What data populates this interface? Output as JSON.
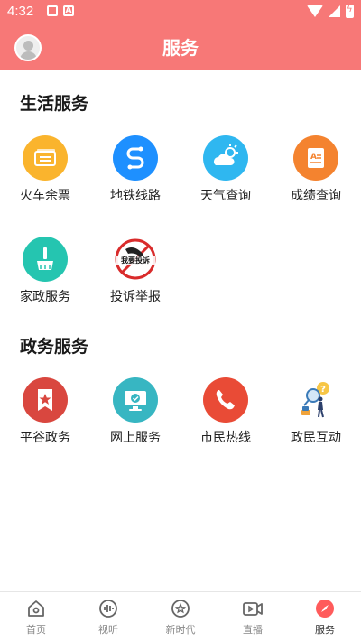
{
  "status_bar": {
    "time": "4:32"
  },
  "header": {
    "title": "服务"
  },
  "sections": [
    {
      "title": "生活服务",
      "items": [
        {
          "label": "火车余票",
          "icon": "train-ticket-icon"
        },
        {
          "label": "地铁线路",
          "icon": "metro-route-icon"
        },
        {
          "label": "天气查询",
          "icon": "weather-icon"
        },
        {
          "label": "成绩查询",
          "icon": "score-icon"
        },
        {
          "label": "家政服务",
          "icon": "housekeeping-icon"
        },
        {
          "label": "投诉举报",
          "icon": "complaint-report-icon",
          "badge_text": "我要投诉"
        }
      ]
    },
    {
      "title": "政务服务",
      "items": [
        {
          "label": "平谷政务",
          "icon": "pinggu-gov-icon"
        },
        {
          "label": "网上服务",
          "icon": "online-service-icon"
        },
        {
          "label": "市民热线",
          "icon": "hotline-phone-icon"
        },
        {
          "label": "政民互动",
          "icon": "gov-citizen-interaction-icon"
        }
      ]
    }
  ],
  "bottom_nav": [
    {
      "label": "首页",
      "icon": "home-icon",
      "active": false
    },
    {
      "label": "视听",
      "icon": "audio-video-icon",
      "active": false
    },
    {
      "label": "新时代",
      "icon": "star-icon",
      "active": false
    },
    {
      "label": "直播",
      "icon": "live-video-icon",
      "active": false
    },
    {
      "label": "服务",
      "icon": "compass-icon",
      "active": true
    }
  ],
  "colors": {
    "header": "#f77877",
    "active_nav": "#ff5b5b"
  }
}
